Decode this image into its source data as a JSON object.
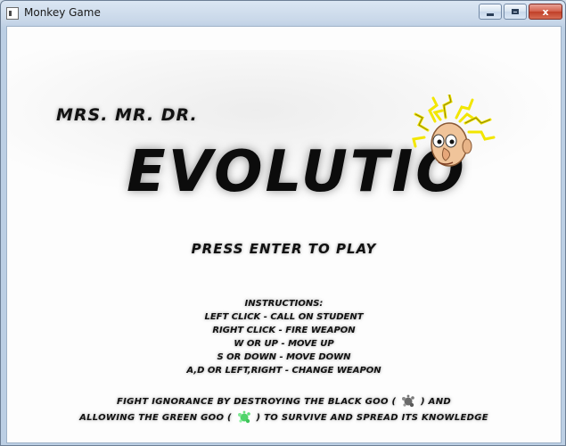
{
  "window": {
    "title": "Monkey Game",
    "controls": {
      "minimize_icon": "minimize-icon",
      "maximize_icon": "maximize-icon",
      "close_label": "x"
    }
  },
  "game": {
    "subtitle": "MRS. MR. DR.",
    "title": "EVOLUTIO",
    "mascot_icon": "professor-head-icon",
    "press_enter": "PRESS ENTER TO PLAY",
    "instructions": {
      "heading": "INSTRUCTIONS:",
      "lines": [
        "LEFT CLICK - CALL ON STUDENT",
        "RIGHT CLICK - FIRE WEAPON",
        "W OR UP - MOVE UP",
        "S OR DOWN - MOVE DOWN",
        "A,D OR LEFT,RIGHT - CHANGE WEAPON"
      ]
    },
    "goal": {
      "line1_before": "FIGHT IGNORANCE BY DESTROYING THE BLACK GOO (",
      "line1_after": ") AND",
      "line2_before": "ALLOWING THE GREEN GOO (",
      "line2_after": ") TO SURVIVE AND SPREAD ITS KNOWLEDGE",
      "black_goo_icon": "black-goo-icon",
      "green_goo_icon": "green-goo-icon"
    }
  },
  "colors": {
    "text": "#111111",
    "green_goo": "#4fd46a",
    "black_goo": "#6a6a6a",
    "hair": "#f2e600"
  }
}
